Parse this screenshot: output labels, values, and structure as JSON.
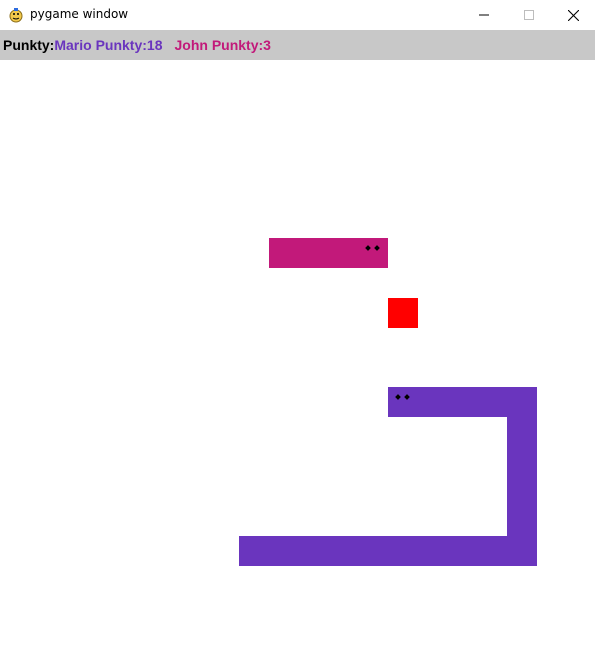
{
  "window": {
    "title": "pygame window",
    "icon": "pygame-snake-icon",
    "controls": [
      "minimize-icon",
      "maximize-icon",
      "close-icon"
    ]
  },
  "scoreboard": {
    "prefix": "Punkty:",
    "player1": "Mario Punkty:18",
    "player2": "John Punkty:3"
  },
  "colors": {
    "player1_snake": "#6a35be",
    "player2_snake": "#c2197a",
    "food": "#ff0000",
    "scorebar_bg": "#c8c8c8"
  }
}
